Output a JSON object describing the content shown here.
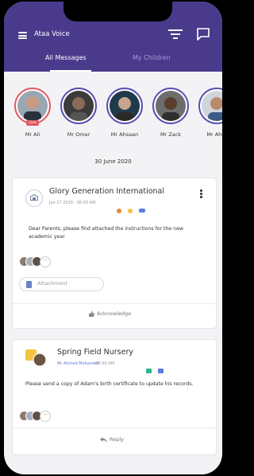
{
  "app": {
    "title": "Ataa Voice",
    "accent_color": "#4a3a8c",
    "header_icons": [
      "menu-icon",
      "filter-icon",
      "chat-icon"
    ]
  },
  "tabs": [
    {
      "label": "All Messages",
      "active": true
    },
    {
      "label": "My Children",
      "active": false
    }
  ],
  "stories": [
    {
      "name": "Mr Ali",
      "live": true,
      "badge": "Live"
    },
    {
      "name": "Mr Omar",
      "live": false
    },
    {
      "name": "Mr Ahsaan",
      "live": false
    },
    {
      "name": "Mr Zack",
      "live": false
    },
    {
      "name": "Mr Ahm",
      "live": false
    }
  ],
  "date_separator": "30 June 2020",
  "messages": [
    {
      "org": "Glory Generation International",
      "meta": "Jan 27 2020 · 08:00 AM",
      "text": "Dear Parents, please find attached the instructions for the new academic year",
      "attachment_label": "Attachment",
      "action_label": "Acknowledge",
      "more_readers": "···"
    },
    {
      "org": "Spring Field Nursery",
      "sender": "Mr Ahmed Mohamed",
      "time": "· 08:00 AM",
      "text": "Please send a copy of Adam's birth certificate to update his records.",
      "action_label": "Reply",
      "more_readers": "···"
    }
  ]
}
